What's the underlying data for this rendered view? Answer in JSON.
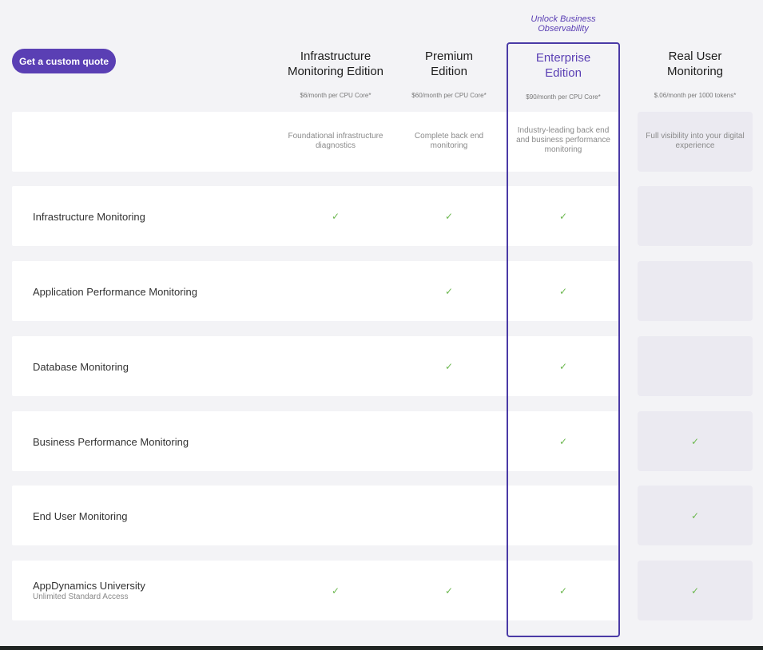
{
  "cta": {
    "label": "Get a custom quote"
  },
  "enterprise_tagline": "Unlock Business Observability",
  "plans": [
    {
      "id": "infra",
      "name": "Infrastructure Monitoring Edition",
      "price": "$6/month per CPU Core*",
      "description": "Foundational infrastructure diagnostics"
    },
    {
      "id": "premium",
      "name": "Premium Edition",
      "price": "$60/month per CPU Core*",
      "description": "Complete back end monitoring"
    },
    {
      "id": "enterprise",
      "name": "Enterprise Edition",
      "price": "$90/month per CPU Core*",
      "description": "Industry-leading back end and business performance monitoring"
    },
    {
      "id": "rum",
      "name": "Real User Monitoring",
      "price": "$.06/month per 1000 tokens*",
      "description": "Full visibility into your digital experience"
    }
  ],
  "features": [
    {
      "label": "Infrastructure Monitoring",
      "sub": "",
      "included": [
        true,
        true,
        true,
        false
      ]
    },
    {
      "label": "Application Performance Monitoring",
      "sub": "",
      "included": [
        false,
        true,
        true,
        false
      ]
    },
    {
      "label": "Database Monitoring",
      "sub": "",
      "included": [
        false,
        true,
        true,
        false
      ]
    },
    {
      "label": "Business Performance Monitoring",
      "sub": "",
      "included": [
        false,
        false,
        true,
        true
      ]
    },
    {
      "label": "End User Monitoring",
      "sub": "",
      "included": [
        false,
        false,
        false,
        true
      ]
    },
    {
      "label": "AppDynamics University",
      "sub": "Unlimited Standard Access",
      "included": [
        true,
        true,
        true,
        true
      ]
    }
  ],
  "check_glyph": "✓",
  "colors": {
    "accent": "#5a3fb4",
    "check": "#6cb84f",
    "rum_cell": "#ebeaf1"
  }
}
